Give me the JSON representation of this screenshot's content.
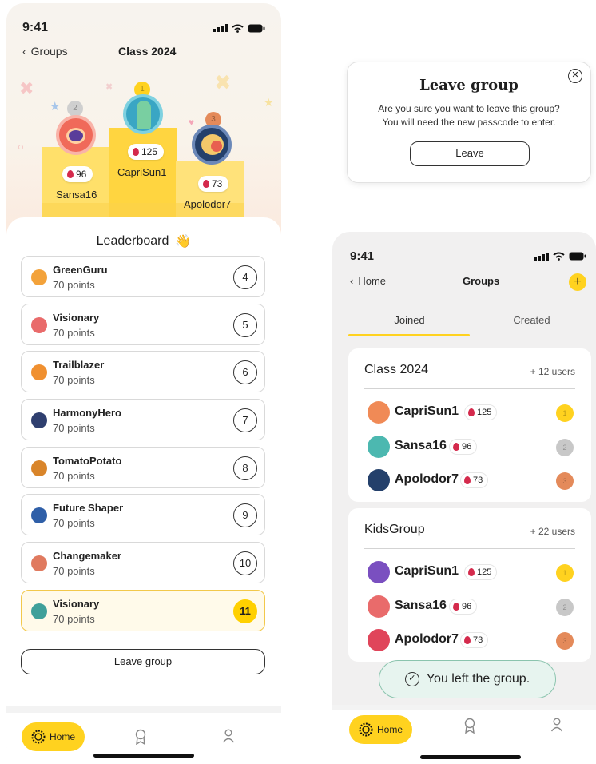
{
  "left_screen": {
    "status": {
      "time": "9:41"
    },
    "nav": {
      "back_label": "Groups",
      "title": "Class 2024"
    },
    "podium": [
      {
        "name": "Sansa16",
        "score": "96",
        "medal": "2"
      },
      {
        "name": "CapriSun1",
        "score": "125",
        "medal": "1"
      },
      {
        "name": "Apolodor7",
        "score": "73",
        "medal": "3"
      }
    ],
    "leaderboard_title": "Leaderboard",
    "leaderboard_emoji": "👋",
    "rankings": [
      {
        "name": "GreenGuru",
        "points": "70 points",
        "rank": "4",
        "color": "#f3a23a"
      },
      {
        "name": "Visionary",
        "points": "70 points",
        "rank": "5",
        "color": "#e96b6b"
      },
      {
        "name": "Trailblazer",
        "points": "70 points",
        "rank": "6",
        "color": "#f09030"
      },
      {
        "name": "HarmonyHero",
        "points": "70 points",
        "rank": "7",
        "color": "#2f3f6f"
      },
      {
        "name": "TomatoPotato",
        "points": "70 points",
        "rank": "8",
        "color": "#d9852a"
      },
      {
        "name": "Future Shaper",
        "points": "70 points",
        "rank": "9",
        "color": "#2f5fa8"
      },
      {
        "name": "Changemaker",
        "points": "70 points",
        "rank": "10",
        "color": "#e07a5f"
      },
      {
        "name": "Visionary",
        "points": "70 points",
        "rank": "11",
        "color": "#3fa09a"
      }
    ],
    "leave_button": "Leave group",
    "tabbar": {
      "home_label": "Home"
    }
  },
  "dialog": {
    "title": "Leave group",
    "message_line1": "Are you sure you want to leave this group?",
    "message_line2": "You will need the new passcode to enter.",
    "leave_button": "Leave"
  },
  "right_screen": {
    "status": {
      "time": "9:41"
    },
    "nav": {
      "back_label": "Home",
      "title": "Groups",
      "add_symbol": "+"
    },
    "tabs": {
      "joined": "Joined",
      "created": "Created"
    },
    "groups": [
      {
        "name": "Class 2024",
        "users": "+ 12 users",
        "members": [
          {
            "name": "CapriSun1",
            "score": "125",
            "medal": "1",
            "medal_color": "#ffd21f",
            "avatar_color": "#f08a56"
          },
          {
            "name": "Sansa16",
            "score": "96",
            "medal": "2",
            "medal_color": "#c8c8c8",
            "avatar_color": "#4cb8b0"
          },
          {
            "name": "Apolodor7",
            "score": "73",
            "medal": "3",
            "medal_color": "#e48a5a",
            "avatar_color": "#24406b"
          }
        ]
      },
      {
        "name": "KidsGroup",
        "users": "+ 22 users",
        "members": [
          {
            "name": "CapriSun1",
            "score": "125",
            "medal": "1",
            "medal_color": "#ffd21f",
            "avatar_color": "#7a4fc0"
          },
          {
            "name": "Sansa16",
            "score": "96",
            "medal": "2",
            "medal_color": "#c8c8c8",
            "avatar_color": "#e96b6b"
          },
          {
            "name": "Apolodor7",
            "score": "73",
            "medal": "3",
            "medal_color": "#e48a5a",
            "avatar_color": "#e0455a"
          }
        ]
      }
    ],
    "toast": "You left the group.",
    "tabbar": {
      "home_label": "Home"
    }
  },
  "colors": {
    "accent_yellow": "#ffd21f",
    "score_drop": "#d42a4c",
    "toast_bg": "#e7f4ef"
  }
}
